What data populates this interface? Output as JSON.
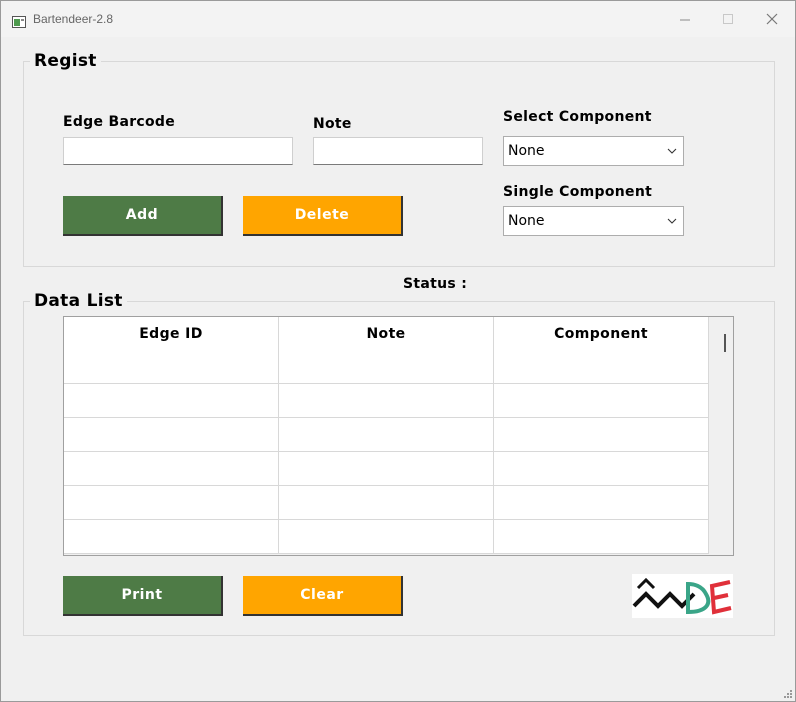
{
  "window": {
    "title": "Bartendeer-2.8"
  },
  "regist": {
    "group_title": "Regist",
    "edge_barcode_label": "Edge Barcode",
    "edge_barcode_value": "",
    "note_label": "Note",
    "note_value": "",
    "select_component_label": "Select Component",
    "select_component_value": "None",
    "single_component_label": "Single Component",
    "single_component_value": "None",
    "add_label": "Add",
    "delete_label": "Delete"
  },
  "status": {
    "label": "Status :"
  },
  "data_list": {
    "group_title": "Data List",
    "columns": [
      "Edge ID",
      "Note",
      "Component"
    ],
    "rows": [
      [
        "",
        "",
        ""
      ],
      [
        "",
        "",
        ""
      ],
      [
        "",
        "",
        ""
      ],
      [
        "",
        "",
        ""
      ],
      [
        "",
        "",
        ""
      ]
    ]
  },
  "bottom": {
    "print_label": "Print",
    "clear_label": "Clear"
  },
  "icons": {
    "app": "app-window-icon",
    "minimize": "minimize-icon",
    "maximize": "maximize-icon",
    "close": "close-icon",
    "dropdown": "chevron-down-icon",
    "logo": "company-logo",
    "grip": "resize-grip-icon"
  },
  "colors": {
    "green_button": "#4e7b46",
    "orange_button": "#ffa500",
    "logo_red": "#e0303a",
    "logo_teal": "#3aa588"
  }
}
